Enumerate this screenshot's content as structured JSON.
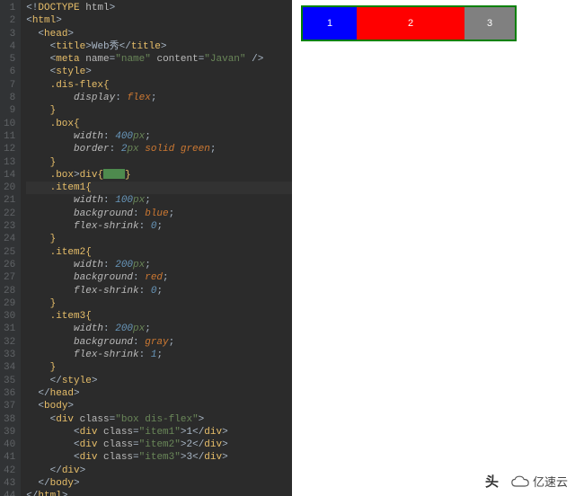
{
  "editor": {
    "lines": [
      {
        "n": "1",
        "segs": [
          {
            "c": "punc",
            "t": "<!"
          },
          {
            "c": "tag",
            "t": "DOCTYPE "
          },
          {
            "c": "attr",
            "t": "html"
          },
          {
            "c": "punc",
            "t": ">"
          }
        ]
      },
      {
        "n": "2",
        "segs": [
          {
            "c": "punc",
            "t": "<"
          },
          {
            "c": "tag",
            "t": "html"
          },
          {
            "c": "punc",
            "t": ">"
          }
        ]
      },
      {
        "n": "3",
        "segs": [
          {
            "c": "txt",
            "t": "  "
          },
          {
            "c": "punc",
            "t": "<"
          },
          {
            "c": "tag",
            "t": "head"
          },
          {
            "c": "punc",
            "t": ">"
          }
        ]
      },
      {
        "n": "4",
        "segs": [
          {
            "c": "txt",
            "t": "    "
          },
          {
            "c": "punc",
            "t": "<"
          },
          {
            "c": "tag",
            "t": "title"
          },
          {
            "c": "punc",
            "t": ">"
          },
          {
            "c": "txt",
            "t": "Web秀"
          },
          {
            "c": "punc",
            "t": "</"
          },
          {
            "c": "tag",
            "t": "title"
          },
          {
            "c": "punc",
            "t": ">"
          }
        ]
      },
      {
        "n": "5",
        "segs": [
          {
            "c": "txt",
            "t": "    "
          },
          {
            "c": "punc",
            "t": "<"
          },
          {
            "c": "tag",
            "t": "meta "
          },
          {
            "c": "attr",
            "t": "name"
          },
          {
            "c": "punc",
            "t": "="
          },
          {
            "c": "str",
            "t": "\"name\" "
          },
          {
            "c": "attr",
            "t": "content"
          },
          {
            "c": "punc",
            "t": "="
          },
          {
            "c": "str",
            "t": "\"Javan\" "
          },
          {
            "c": "punc",
            "t": "/>"
          }
        ]
      },
      {
        "n": "6",
        "segs": [
          {
            "c": "txt",
            "t": "    "
          },
          {
            "c": "punc",
            "t": "<"
          },
          {
            "c": "tag",
            "t": "style"
          },
          {
            "c": "punc",
            "t": ">"
          }
        ]
      },
      {
        "n": "7",
        "segs": [
          {
            "c": "txt",
            "t": "    "
          },
          {
            "c": "sel",
            "t": ".dis-flex"
          },
          {
            "c": "brkt",
            "t": "{"
          }
        ]
      },
      {
        "n": "8",
        "segs": [
          {
            "c": "txt",
            "t": "        "
          },
          {
            "c": "prop",
            "t": "display"
          },
          {
            "c": "punc",
            "t": ": "
          },
          {
            "c": "kw",
            "t": "flex"
          },
          {
            "c": "punc",
            "t": ";"
          }
        ]
      },
      {
        "n": "9",
        "segs": [
          {
            "c": "txt",
            "t": "    "
          },
          {
            "c": "brkt",
            "t": "}"
          }
        ]
      },
      {
        "n": "10",
        "segs": [
          {
            "c": "txt",
            "t": "    "
          },
          {
            "c": "sel",
            "t": ".box"
          },
          {
            "c": "brkt",
            "t": "{"
          }
        ]
      },
      {
        "n": "11",
        "segs": [
          {
            "c": "txt",
            "t": "        "
          },
          {
            "c": "prop",
            "t": "width"
          },
          {
            "c": "punc",
            "t": ": "
          },
          {
            "c": "num",
            "t": "400"
          },
          {
            "c": "unit",
            "t": "px"
          },
          {
            "c": "punc",
            "t": ";"
          }
        ]
      },
      {
        "n": "12",
        "segs": [
          {
            "c": "txt",
            "t": "        "
          },
          {
            "c": "prop",
            "t": "border"
          },
          {
            "c": "punc",
            "t": ": "
          },
          {
            "c": "num",
            "t": "2"
          },
          {
            "c": "unit",
            "t": "px "
          },
          {
            "c": "kw",
            "t": "solid "
          },
          {
            "c": "kw",
            "t": "green"
          },
          {
            "c": "punc",
            "t": ";"
          }
        ]
      },
      {
        "n": "13",
        "segs": [
          {
            "c": "txt",
            "t": "    "
          },
          {
            "c": "brkt",
            "t": "}"
          }
        ]
      },
      {
        "n": "14",
        "segs": [
          {
            "c": "txt",
            "t": "    "
          },
          {
            "c": "sel",
            "t": ".box"
          },
          {
            "c": "punc",
            "t": ">"
          },
          {
            "c": "sel",
            "t": "div"
          },
          {
            "c": "brkt",
            "t": "{"
          },
          {
            "caret": true
          },
          {
            "c": "brkt",
            "t": "}"
          }
        ]
      },
      {
        "n": "20",
        "hl": true,
        "segs": [
          {
            "c": "txt",
            "t": "    "
          },
          {
            "c": "sel",
            "t": ".item1"
          },
          {
            "c": "brkt",
            "t": "{"
          }
        ]
      },
      {
        "n": "21",
        "segs": [
          {
            "c": "txt",
            "t": "        "
          },
          {
            "c": "prop",
            "t": "width"
          },
          {
            "c": "punc",
            "t": ": "
          },
          {
            "c": "num",
            "t": "100"
          },
          {
            "c": "unit",
            "t": "px"
          },
          {
            "c": "punc",
            "t": ";"
          }
        ]
      },
      {
        "n": "22",
        "segs": [
          {
            "c": "txt",
            "t": "        "
          },
          {
            "c": "prop",
            "t": "background"
          },
          {
            "c": "punc",
            "t": ": "
          },
          {
            "c": "kw",
            "t": "blue"
          },
          {
            "c": "punc",
            "t": ";"
          }
        ]
      },
      {
        "n": "23",
        "segs": [
          {
            "c": "txt",
            "t": "        "
          },
          {
            "c": "prop",
            "t": "flex-shrink"
          },
          {
            "c": "punc",
            "t": ": "
          },
          {
            "c": "num",
            "t": "0"
          },
          {
            "c": "punc",
            "t": ";"
          }
        ]
      },
      {
        "n": "24",
        "segs": [
          {
            "c": "txt",
            "t": "    "
          },
          {
            "c": "brkt",
            "t": "}"
          }
        ]
      },
      {
        "n": "25",
        "segs": [
          {
            "c": "txt",
            "t": "    "
          },
          {
            "c": "sel",
            "t": ".item2"
          },
          {
            "c": "brkt",
            "t": "{"
          }
        ]
      },
      {
        "n": "26",
        "segs": [
          {
            "c": "txt",
            "t": "        "
          },
          {
            "c": "prop",
            "t": "width"
          },
          {
            "c": "punc",
            "t": ": "
          },
          {
            "c": "num",
            "t": "200"
          },
          {
            "c": "unit",
            "t": "px"
          },
          {
            "c": "punc",
            "t": ";"
          }
        ]
      },
      {
        "n": "27",
        "segs": [
          {
            "c": "txt",
            "t": "        "
          },
          {
            "c": "prop",
            "t": "background"
          },
          {
            "c": "punc",
            "t": ": "
          },
          {
            "c": "kw",
            "t": "red"
          },
          {
            "c": "punc",
            "t": ";"
          }
        ]
      },
      {
        "n": "28",
        "segs": [
          {
            "c": "txt",
            "t": "        "
          },
          {
            "c": "prop",
            "t": "flex-shrink"
          },
          {
            "c": "punc",
            "t": ": "
          },
          {
            "c": "num",
            "t": "0"
          },
          {
            "c": "punc",
            "t": ";"
          }
        ]
      },
      {
        "n": "29",
        "segs": [
          {
            "c": "txt",
            "t": "    "
          },
          {
            "c": "brkt",
            "t": "}"
          }
        ]
      },
      {
        "n": "30",
        "segs": [
          {
            "c": "txt",
            "t": "    "
          },
          {
            "c": "sel",
            "t": ".item3"
          },
          {
            "c": "brkt",
            "t": "{"
          }
        ]
      },
      {
        "n": "31",
        "segs": [
          {
            "c": "txt",
            "t": "        "
          },
          {
            "c": "prop",
            "t": "width"
          },
          {
            "c": "punc",
            "t": ": "
          },
          {
            "c": "num",
            "t": "200"
          },
          {
            "c": "unit",
            "t": "px"
          },
          {
            "c": "punc",
            "t": ";"
          }
        ]
      },
      {
        "n": "32",
        "segs": [
          {
            "c": "txt",
            "t": "        "
          },
          {
            "c": "prop",
            "t": "background"
          },
          {
            "c": "punc",
            "t": ": "
          },
          {
            "c": "kw",
            "t": "gray"
          },
          {
            "c": "punc",
            "t": ";"
          }
        ]
      },
      {
        "n": "33",
        "segs": [
          {
            "c": "txt",
            "t": "        "
          },
          {
            "c": "prop",
            "t": "flex-shrink"
          },
          {
            "c": "punc",
            "t": ": "
          },
          {
            "c": "num",
            "t": "1"
          },
          {
            "c": "punc",
            "t": ";"
          }
        ]
      },
      {
        "n": "34",
        "segs": [
          {
            "c": "txt",
            "t": "    "
          },
          {
            "c": "brkt",
            "t": "}"
          }
        ]
      },
      {
        "n": "35",
        "segs": [
          {
            "c": "txt",
            "t": "    "
          },
          {
            "c": "punc",
            "t": "</"
          },
          {
            "c": "tag",
            "t": "style"
          },
          {
            "c": "punc",
            "t": ">"
          }
        ]
      },
      {
        "n": "36",
        "segs": [
          {
            "c": "txt",
            "t": "  "
          },
          {
            "c": "punc",
            "t": "</"
          },
          {
            "c": "tag",
            "t": "head"
          },
          {
            "c": "punc",
            "t": ">"
          }
        ]
      },
      {
        "n": "37",
        "segs": [
          {
            "c": "txt",
            "t": "  "
          },
          {
            "c": "punc",
            "t": "<"
          },
          {
            "c": "tag",
            "t": "body"
          },
          {
            "c": "punc",
            "t": ">"
          }
        ]
      },
      {
        "n": "38",
        "segs": [
          {
            "c": "txt",
            "t": "    "
          },
          {
            "c": "punc",
            "t": "<"
          },
          {
            "c": "tag",
            "t": "div "
          },
          {
            "c": "attr",
            "t": "class"
          },
          {
            "c": "punc",
            "t": "="
          },
          {
            "c": "str",
            "t": "\"box dis-flex\""
          },
          {
            "c": "punc",
            "t": ">"
          }
        ]
      },
      {
        "n": "39",
        "segs": [
          {
            "c": "txt",
            "t": "        "
          },
          {
            "c": "punc",
            "t": "<"
          },
          {
            "c": "tag",
            "t": "div "
          },
          {
            "c": "attr",
            "t": "class"
          },
          {
            "c": "punc",
            "t": "="
          },
          {
            "c": "str",
            "t": "\"item1\""
          },
          {
            "c": "punc",
            "t": ">"
          },
          {
            "c": "txt",
            "t": "1"
          },
          {
            "c": "punc",
            "t": "</"
          },
          {
            "c": "tag",
            "t": "div"
          },
          {
            "c": "punc",
            "t": ">"
          }
        ]
      },
      {
        "n": "40",
        "segs": [
          {
            "c": "txt",
            "t": "        "
          },
          {
            "c": "punc",
            "t": "<"
          },
          {
            "c": "tag",
            "t": "div "
          },
          {
            "c": "attr",
            "t": "class"
          },
          {
            "c": "punc",
            "t": "="
          },
          {
            "c": "str",
            "t": "\"item2\""
          },
          {
            "c": "punc",
            "t": ">"
          },
          {
            "c": "txt",
            "t": "2"
          },
          {
            "c": "punc",
            "t": "</"
          },
          {
            "c": "tag",
            "t": "div"
          },
          {
            "c": "punc",
            "t": ">"
          }
        ]
      },
      {
        "n": "41",
        "segs": [
          {
            "c": "txt",
            "t": "        "
          },
          {
            "c": "punc",
            "t": "<"
          },
          {
            "c": "tag",
            "t": "div "
          },
          {
            "c": "attr",
            "t": "class"
          },
          {
            "c": "punc",
            "t": "="
          },
          {
            "c": "str",
            "t": "\"item3\""
          },
          {
            "c": "punc",
            "t": ">"
          },
          {
            "c": "txt",
            "t": "3"
          },
          {
            "c": "punc",
            "t": "</"
          },
          {
            "c": "tag",
            "t": "div"
          },
          {
            "c": "punc",
            "t": ">"
          }
        ]
      },
      {
        "n": "42",
        "segs": [
          {
            "c": "txt",
            "t": "    "
          },
          {
            "c": "punc",
            "t": "</"
          },
          {
            "c": "tag",
            "t": "div"
          },
          {
            "c": "punc",
            "t": ">"
          }
        ]
      },
      {
        "n": "43",
        "segs": [
          {
            "c": "txt",
            "t": "  "
          },
          {
            "c": "punc",
            "t": "</"
          },
          {
            "c": "tag",
            "t": "body"
          },
          {
            "c": "punc",
            "t": ">"
          }
        ]
      },
      {
        "n": "44",
        "segs": [
          {
            "c": "punc",
            "t": "</"
          },
          {
            "c": "tag",
            "t": "html"
          },
          {
            "c": "punc",
            "t": ">"
          }
        ]
      }
    ]
  },
  "preview": {
    "items": [
      "1",
      "2",
      "3"
    ]
  },
  "watermark": {
    "left": "头",
    "right": "亿速云"
  }
}
